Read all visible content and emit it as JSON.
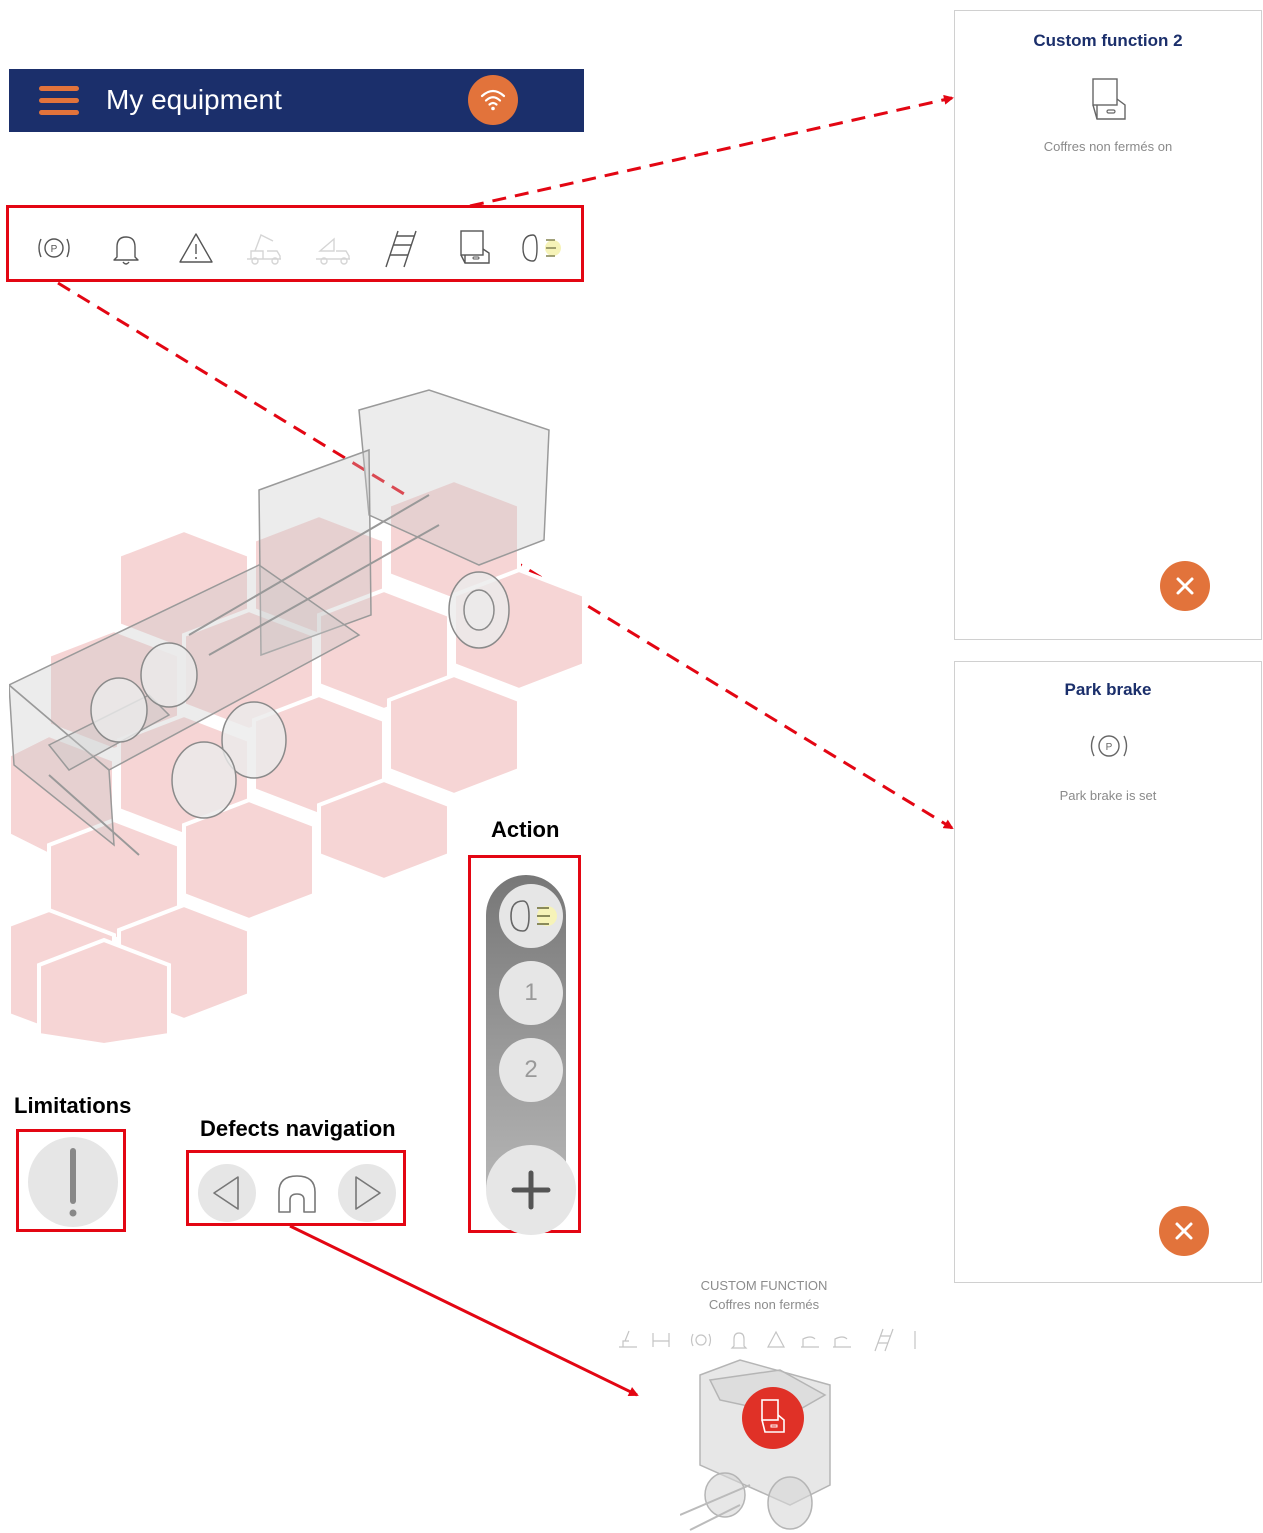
{
  "header": {
    "title": "My equipment",
    "menu_icon": "hamburger-icon",
    "connection_icon": "wifi-icon",
    "brand_color": "#1b2f6b",
    "accent_color": "#e2733b"
  },
  "status_icons": [
    "park-brake-icon",
    "bell-icon",
    "warning-icon",
    "crane-truck-icon",
    "tipper-truck-icon",
    "ladder-icon",
    "box-icon",
    "headlight-icon"
  ],
  "annotations": {
    "action": "Action",
    "limitations": "Limitations",
    "defects_navigation": "Defects navigation",
    "highlight_color": "#e30613"
  },
  "action_menu": {
    "items": [
      "1",
      "2"
    ],
    "first_icon": "headlight-icon",
    "add_icon": "plus-icon"
  },
  "limitations_button": {
    "icon": "exclamation-icon"
  },
  "defects_nav": {
    "prev_icon": "triangle-left-icon",
    "home_icon": "home-icon",
    "next_icon": "triangle-right-icon"
  },
  "panels": [
    {
      "title": "Custom function 2",
      "icon": "box-icon",
      "message": "Coffres non fermés on",
      "close_icon": "close-icon"
    },
    {
      "title": "Park brake",
      "icon": "park-brake-icon",
      "message": "Park brake is set",
      "close_icon": "close-icon"
    }
  ],
  "preview": {
    "heading": "CUSTOM FUNCTION",
    "subheading": "Coffres non fermés",
    "marker_icon": "box-icon",
    "marker_color": "#e03127"
  }
}
